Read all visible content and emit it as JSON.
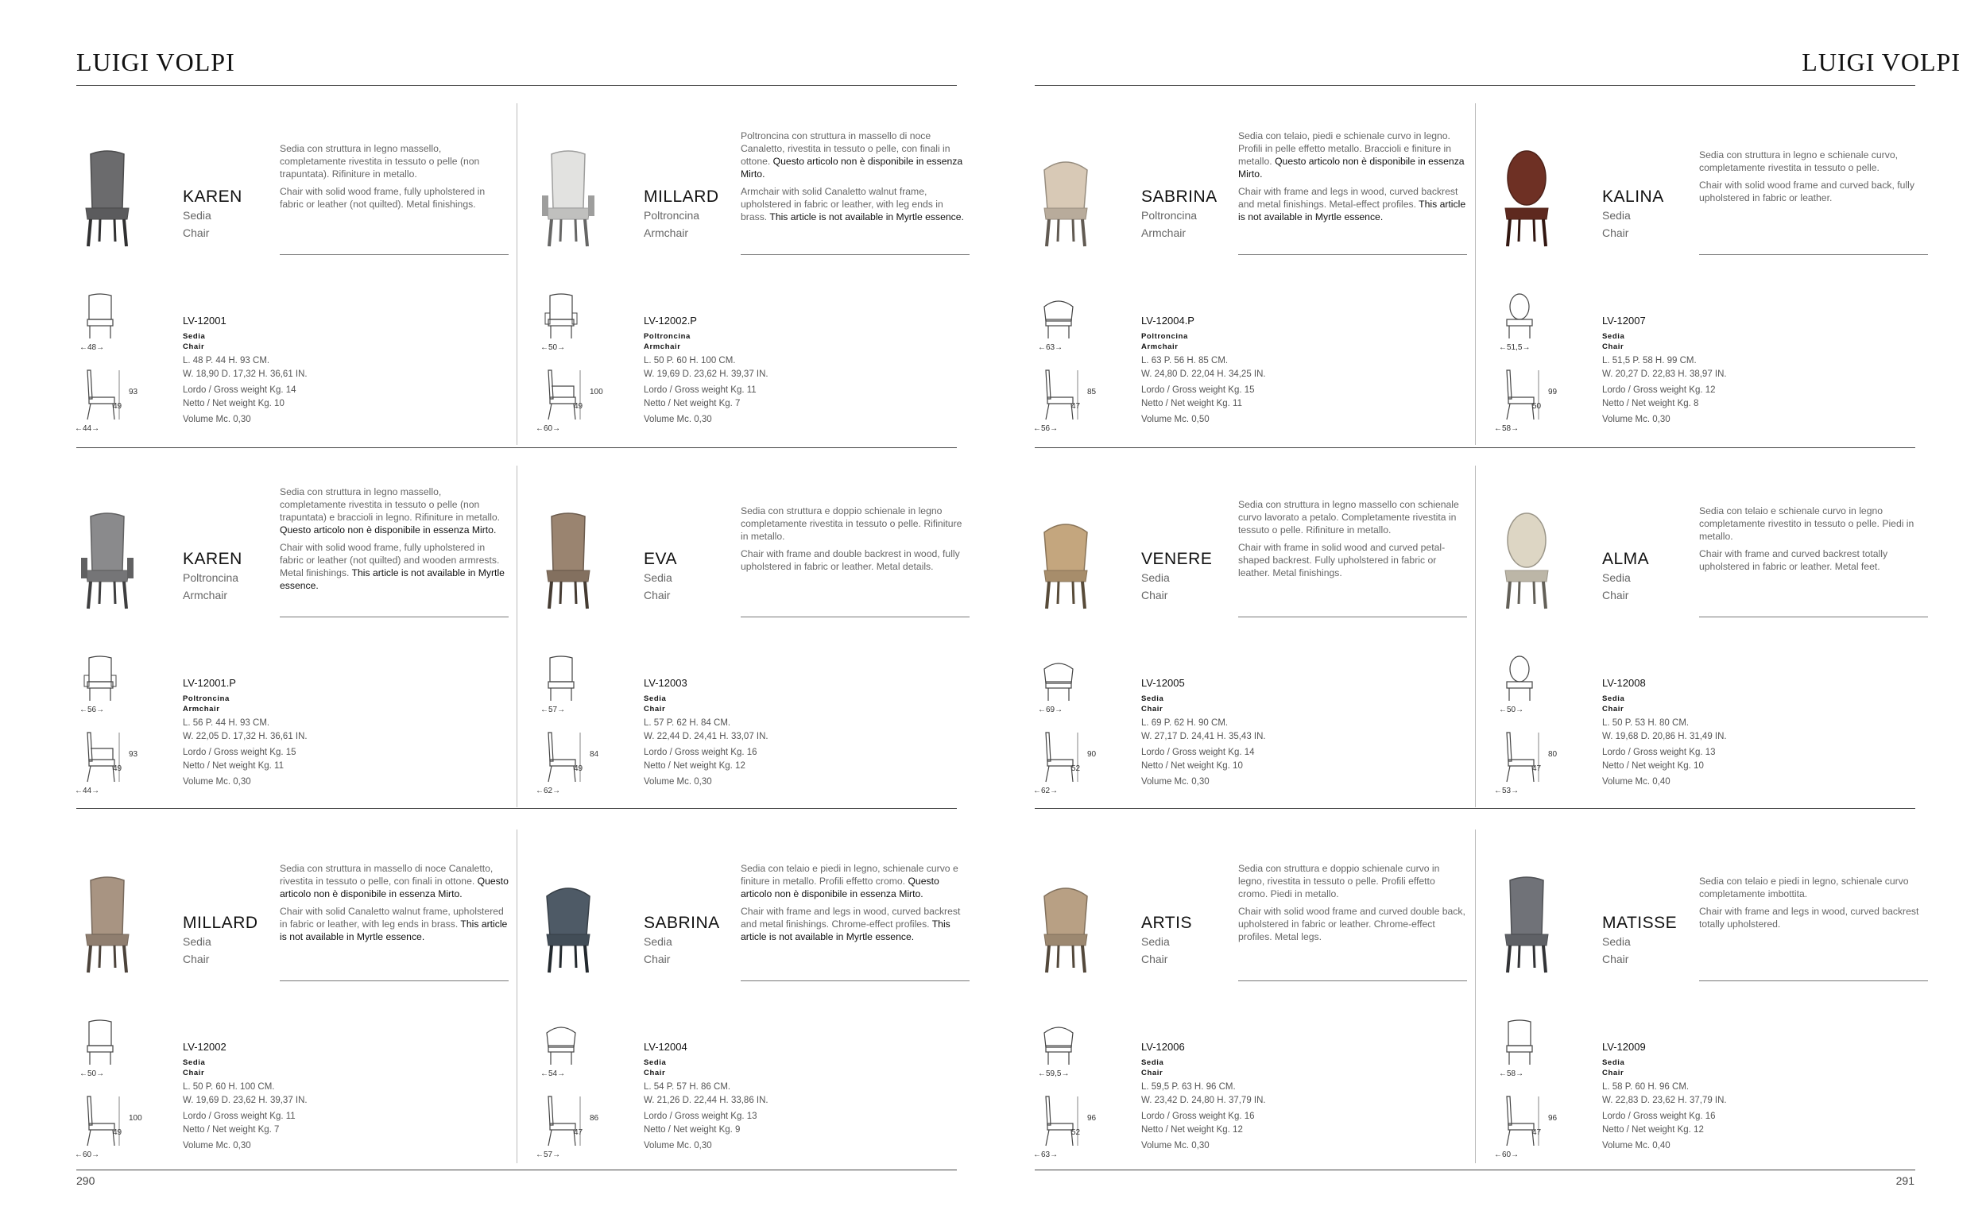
{
  "brand_left": "LUIGI VOLPI",
  "brand_right": "LUIGI VOLPI",
  "page_left": "290",
  "page_right": "291",
  "products": [
    {
      "name": "KAREN",
      "sub1": "Sedia",
      "sub2": "Chair",
      "color": "#6b6b6d",
      "type": "side",
      "desc_it": "Sedia con struttura in legno massello, completamente rivestita in tessuto o pelle (non trapuntata). Rifiniture in metallo.",
      "desc_en": "Chair with solid wood frame, fully upholstered in fabric or leather (not quilted). Metal finishings.",
      "code": "LV-12001",
      "type_it": "Sedia",
      "type_en": "Chair",
      "dims_cm": "L. 48  P. 44   H. 93  CM.",
      "dims_in": "W. 18,90  D. 17,32   H. 36,61  IN.",
      "gross": "Lordo / Gross weight Kg. 14",
      "net": "Netto / Net weight Kg. 10",
      "volume": "Volume Mc. 0,30",
      "w1": "←48→",
      "w2": "←44→",
      "h": "93",
      "seat": "49"
    },
    {
      "name": "MILLARD",
      "sub1": "Poltroncina",
      "sub2": "Armchair",
      "color": "#e2e2e0",
      "type": "arm",
      "desc_it": "Poltroncina con struttura in massello di noce Canaletto, rivestita in tessuto o pelle, con finali in ottone.",
      "desc_it_bold": "Questo articolo non è disponibile in essenza Mirto.",
      "desc_en": "Armchair with solid Canaletto walnut frame, upholstered in fabric or leather, with leg ends in brass.",
      "desc_en_bold": "This article is not available in Myrtle essence.",
      "code": "LV-12002.P",
      "type_it": "Poltroncina",
      "type_en": "Armchair",
      "dims_cm": "L. 50  P. 60   H. 100  CM.",
      "dims_in": "W. 19,69  D. 23,62   H. 39,37  IN.",
      "gross": "Lordo / Gross weight Kg. 11",
      "net": "Netto / Net weight Kg. 7",
      "volume": "Volume Mc. 0,30",
      "w1": "←50→",
      "w2": "←60→",
      "h": "100",
      "seat": "49"
    },
    {
      "name": "SABRINA",
      "sub1": "Poltroncina",
      "sub2": "Armchair",
      "color": "#d8c9b6",
      "type": "tub",
      "desc_it": "Sedia con telaio, piedi e schienale curvo in legno. Profili in pelle effetto metallo. Braccioli e finiture in metallo.",
      "desc_it_bold": "Questo articolo non è disponibile in essenza Mirto.",
      "desc_en": "Chair with frame and legs in wood, curved backrest and metal finishings. Metal-effect profiles.",
      "desc_en_bold": "This article is not available in Myrtle essence.",
      "code": "LV-12004.P",
      "type_it": "Poltroncina",
      "type_en": "Armchair",
      "dims_cm": "L. 63  P. 56   H. 85  CM.",
      "dims_in": "W. 24,80  D. 22,04   H. 34,25  IN.",
      "gross": "Lordo / Gross weight Kg. 15",
      "net": "Netto / Net weight Kg. 11",
      "volume": "Volume Mc. 0,50",
      "w1": "←63→",
      "w2": "←56→",
      "h": "85",
      "seat": "47"
    },
    {
      "name": "KALINA",
      "sub1": "Sedia",
      "sub2": "Chair",
      "color": "#6e3024",
      "type": "oval",
      "desc_it": "Sedia con struttura in legno e schienale curvo, completamente rivestita in tessuto o pelle.",
      "desc_en": "Chair with solid wood frame and curved back, fully upholstered in fabric or leather.",
      "code": "LV-12007",
      "type_it": "Sedia",
      "type_en": "Chair",
      "dims_cm": "L. 51,5  P. 58   H. 99  CM.",
      "dims_in": "W. 20,27  D. 22,83   H. 38,97  IN.",
      "gross": "Lordo / Gross weight Kg. 12",
      "net": "Netto / Net weight Kg. 8",
      "volume": "Volume Mc. 0,30",
      "w1": "←51,5→",
      "w2": "←58→",
      "h": "99",
      "seat": "50"
    },
    {
      "name": "KAREN",
      "sub1": "Poltroncina",
      "sub2": "Armchair",
      "color": "#8a8a8c",
      "type": "arm",
      "desc_it": "Sedia con struttura in legno massello, completamente rivestita in tessuto o pelle (non trapuntata) e braccioli in legno. Rifiniture in metallo.",
      "desc_it_bold": "Questo articolo non è disponibile in essenza Mirto.",
      "desc_en": "Chair with solid wood frame, fully upholstered in fabric or leather (not quilted) and wooden armrests. Metal finishings.",
      "desc_en_bold": "This article is not available in Myrtle essence.",
      "code": "LV-12001.P",
      "type_it": "Poltroncina",
      "type_en": "Armchair",
      "dims_cm": "L. 56  P. 44   H. 93  CM.",
      "dims_in": "W. 22,05  D. 17,32   H. 36,61  IN.",
      "gross": "Lordo / Gross weight Kg. 15",
      "net": "Netto / Net weight Kg. 11",
      "volume": "Volume Mc. 0,30",
      "w1": "←56→",
      "w2": "←44→",
      "h": "93",
      "seat": "49"
    },
    {
      "name": "EVA",
      "sub1": "Sedia",
      "sub2": "Chair",
      "color": "#9a8470",
      "type": "side",
      "desc_it": "Sedia con struttura e doppio schienale in legno completamente rivestita in tessuto o pelle. Rifiniture in metallo.",
      "desc_en": "Chair with frame and double backrest in wood, fully upholstered in fabric or leather. Metal details.",
      "code": "LV-12003",
      "type_it": "Sedia",
      "type_en": "Chair",
      "dims_cm": "L. 57  P. 62   H. 84  CM.",
      "dims_in": "W. 22,44  D. 24,41   H. 33,07  IN.",
      "gross": "Lordo / Gross weight Kg. 16",
      "net": "Netto / Net weight Kg. 12",
      "volume": "Volume Mc. 0,30",
      "w1": "←57→",
      "w2": "←62→",
      "h": "84",
      "seat": "49"
    },
    {
      "name": "VENERE",
      "sub1": "Sedia",
      "sub2": "Chair",
      "color": "#c4a67e",
      "type": "tub",
      "desc_it": "Sedia con struttura in legno massello con schienale curvo lavorato a petalo. Completamente rivestita in tessuto o pelle. Rifiniture in metallo.",
      "desc_en": "Chair with frame in solid wood and curved petal-shaped backrest. Fully upholstered in fabric or leather. Metal finishings.",
      "code": "LV-12005",
      "type_it": "Sedia",
      "type_en": "Chair",
      "dims_cm": "L. 69  P. 62   H. 90  CM.",
      "dims_in": "W. 27,17  D. 24,41   H. 35,43  IN.",
      "gross": "Lordo / Gross weight Kg. 14",
      "net": "Netto / Net weight Kg. 10",
      "volume": "Volume Mc. 0,30",
      "w1": "←69→",
      "w2": "←62→",
      "h": "90",
      "seat": "52"
    },
    {
      "name": "ALMA",
      "sub1": "Sedia",
      "sub2": "Chair",
      "color": "#ddd6c4",
      "type": "oval",
      "desc_it": "Sedia con telaio e schienale curvo in legno completamente rivestito in tessuto o pelle. Piedi in metallo.",
      "desc_en": "Chair with frame and curved backrest totally upholstered in fabric or leather. Metal feet.",
      "code": "LV-12008",
      "type_it": "Sedia",
      "type_en": "Chair",
      "dims_cm": "L. 50  P. 53   H. 80  CM.",
      "dims_in": "W. 19,68  D. 20,86   H. 31,49  IN.",
      "gross": "Lordo / Gross weight Kg. 13",
      "net": "Netto / Net weight Kg. 10",
      "volume": "Volume Mc. 0,40",
      "w1": "←50→",
      "w2": "←53→",
      "h": "80",
      "seat": "47"
    },
    {
      "name": "MILLARD",
      "sub1": "Sedia",
      "sub2": "Chair",
      "color": "#a89482",
      "type": "side",
      "desc_it": "Sedia con struttura in massello di noce Canaletto, rivestita in tessuto o pelle, con finali in ottone.",
      "desc_it_bold": "Questo articolo non è disponibile in essenza Mirto.",
      "desc_en": "Chair with solid Canaletto walnut frame, upholstered in fabric or leather, with leg ends in brass.",
      "desc_en_bold": "This article is not available in Myrtle essence.",
      "code": "LV-12002",
      "type_it": "Sedia",
      "type_en": "Chair",
      "dims_cm": "L. 50  P. 60   H. 100  CM.",
      "dims_in": "W. 19,69  D. 23,62   H. 39,37  IN.",
      "gross": "Lordo / Gross weight Kg. 11",
      "net": "Netto / Net weight Kg. 7",
      "volume": "Volume Mc. 0,30",
      "w1": "←50→",
      "w2": "←60→",
      "h": "100",
      "seat": "49"
    },
    {
      "name": "SABRINA",
      "sub1": "Sedia",
      "sub2": "Chair",
      "color": "#4e5a66",
      "type": "tub",
      "desc_it": "Sedia con telaio e piedi in legno, schienale curvo e finiture in metallo. Profili effetto cromo.",
      "desc_it_bold": "Questo articolo non è disponibile in essenza Mirto.",
      "desc_en": "Chair with frame and legs in wood, curved backrest and metal finishings. Chrome-effect profiles.",
      "desc_en_bold": "This article is not available in Myrtle essence.",
      "code": "LV-12004",
      "type_it": "Sedia",
      "type_en": "Chair",
      "dims_cm": "L. 54  P. 57   H. 86  CM.",
      "dims_in": "W. 21,26  D. 22,44   H. 33,86  IN.",
      "gross": "Lordo / Gross weight Kg. 13",
      "net": "Netto / Net weight Kg. 9",
      "volume": "Volume Mc. 0,30",
      "w1": "←54→",
      "w2": "←57→",
      "h": "86",
      "seat": "47"
    },
    {
      "name": "ARTIS",
      "sub1": "Sedia",
      "sub2": "Chair",
      "color": "#b8a084",
      "type": "tub",
      "desc_it": "Sedia con struttura e doppio schienale curvo in legno, rivestita in tessuto o pelle. Profili effetto cromo. Piedi in metallo.",
      "desc_en": "Chair with solid wood frame and curved double back, upholstered in fabric or leather. Chrome-effect profiles. Metal legs.",
      "code": "LV-12006",
      "type_it": "Sedia",
      "type_en": "Chair",
      "dims_cm": "L. 59,5  P. 63   H. 96  CM.",
      "dims_in": "W. 23,42  D. 24,80   H. 37,79  IN.",
      "gross": "Lordo / Gross weight Kg. 16",
      "net": "Netto / Net weight Kg. 12",
      "volume": "Volume Mc. 0,30",
      "w1": "←59,5→",
      "w2": "←63→",
      "h": "96",
      "seat": "52"
    },
    {
      "name": "MATISSE",
      "sub1": "Sedia",
      "sub2": "Chair",
      "color": "#707278",
      "type": "side",
      "desc_it": "Sedia con telaio e piedi in legno, schienale curvo completamente imbottita.",
      "desc_en": "Chair with frame and legs in wood, curved backrest totally upholstered.",
      "code": "LV-12009",
      "type_it": "Sedia",
      "type_en": "Chair",
      "dims_cm": "L. 58  P. 60   H. 96  CM.",
      "dims_in": "W. 22,83  D. 23,62   H. 37,79  IN.",
      "gross": "Lordo / Gross weight Kg. 16",
      "net": "Netto / Net weight Kg. 12",
      "volume": "Volume Mc. 0,40",
      "w1": "←58→",
      "w2": "←60→",
      "h": "96",
      "seat": "47"
    }
  ]
}
